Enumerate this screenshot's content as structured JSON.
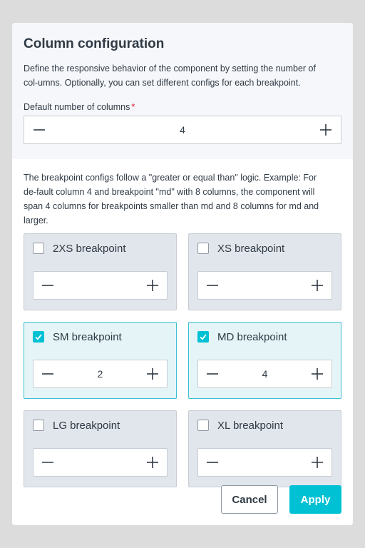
{
  "dialog": {
    "title": "Column configuration",
    "description": "Define the responsive behavior of the component by setting the number of col-umns. Optionally, you can set different configs for each breakpoint.",
    "default_columns_label": "Default number of columns",
    "required_mark": "*",
    "default_columns_value": "4",
    "breakpoint_info": "The breakpoint configs follow a \"greater or equal than\" logic. Example: For de-fault column 4 and breakpoint \"md\" with 8 columns, the component will span 4 columns for breakpoints smaller than md and 8 columns for md and larger."
  },
  "breakpoints": [
    {
      "label": "2XS breakpoint",
      "checked": false,
      "value": ""
    },
    {
      "label": "XS breakpoint",
      "checked": false,
      "value": ""
    },
    {
      "label": "SM breakpoint",
      "checked": true,
      "value": "2"
    },
    {
      "label": "MD breakpoint",
      "checked": true,
      "value": "4"
    },
    {
      "label": "LG breakpoint",
      "checked": false,
      "value": ""
    },
    {
      "label": "XL breakpoint",
      "checked": false,
      "value": ""
    }
  ],
  "footer": {
    "cancel_label": "Cancel",
    "apply_label": "Apply"
  },
  "colors": {
    "accent": "#00c1d4",
    "required": "#e3122a",
    "card_bg": "#e1e6ec",
    "card_active_bg": "#e4f4f7"
  },
  "icons": {
    "decrement": "minus-icon",
    "increment": "plus-icon",
    "checked": "checkmark-icon"
  }
}
